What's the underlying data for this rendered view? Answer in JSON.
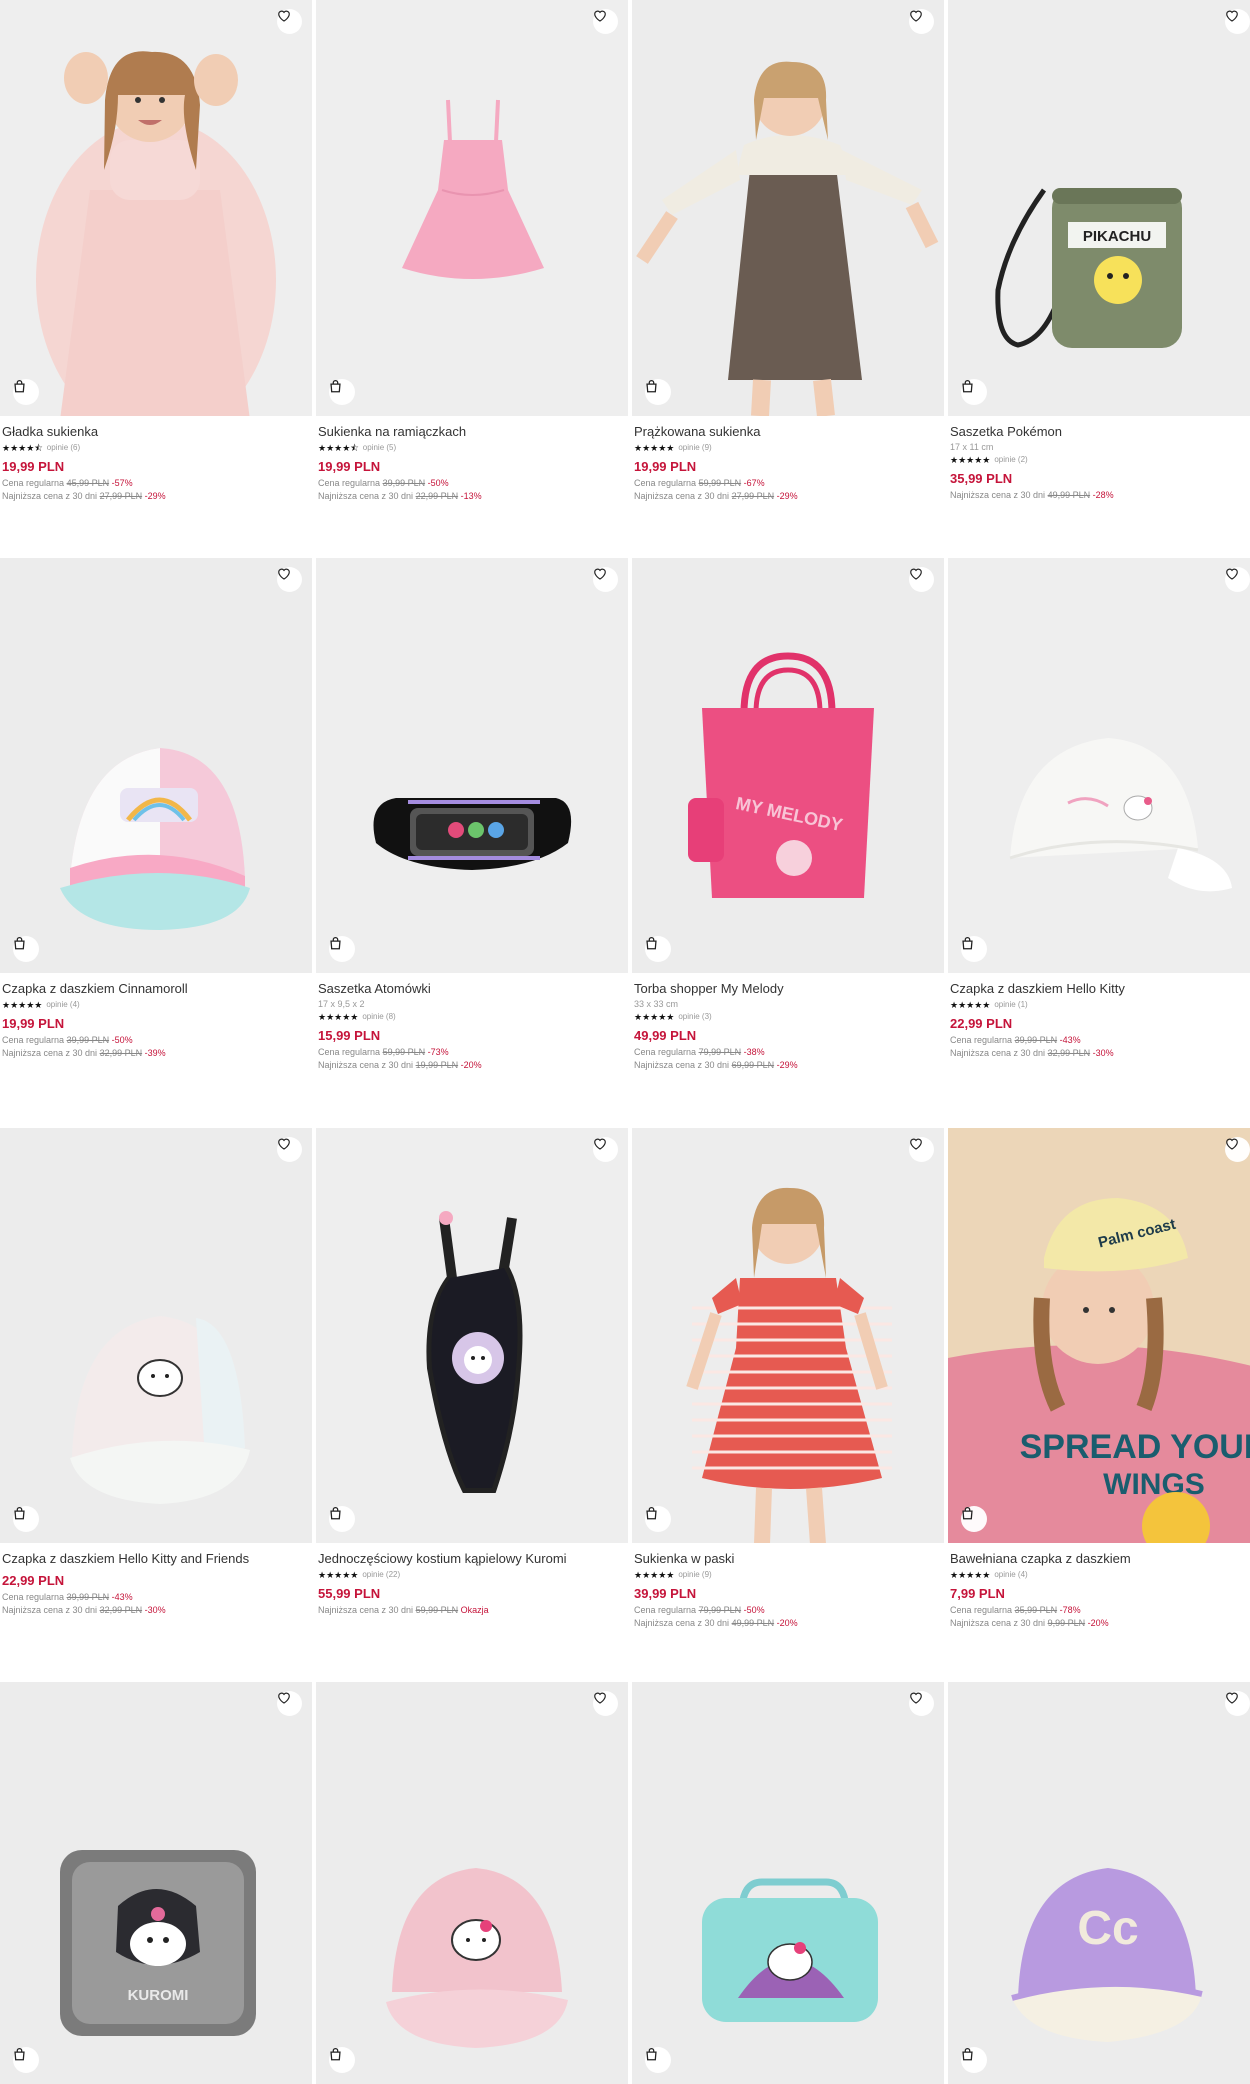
{
  "icons": {
    "favorite": "heart-icon",
    "add_to_cart": "shopping-bag-icon"
  },
  "colors": {
    "price": "#c5143a",
    "discount": "#c5143a"
  },
  "products": [
    {
      "name": "Gładka sukienka",
      "dims": "",
      "reviews": "opinie (6)",
      "rating": 4.5,
      "price": "19,99 PLN",
      "reg_label": "Cena regularna",
      "reg_price": "45,99 PLN",
      "reg_pct": "-57%",
      "low_label": "Najniższa cena z 30 dni",
      "low_price": "27,99 PLN",
      "low_pct": "-29%"
    },
    {
      "name": "Sukienka na ramiączkach",
      "dims": "",
      "reviews": "opinie (5)",
      "rating": 4.5,
      "price": "19,99 PLN",
      "reg_label": "Cena regularna",
      "reg_price": "39,99 PLN",
      "reg_pct": "-50%",
      "low_label": "Najniższa cena z 30 dni",
      "low_price": "22,99 PLN",
      "low_pct": "-13%"
    },
    {
      "name": "Prążkowana sukienka",
      "dims": "",
      "reviews": "opinie (9)",
      "rating": 5,
      "price": "19,99 PLN",
      "reg_label": "Cena regularna",
      "reg_price": "59,99 PLN",
      "reg_pct": "-67%",
      "low_label": "Najniższa cena z 30 dni",
      "low_price": "27,99 PLN",
      "low_pct": "-29%"
    },
    {
      "name": "Saszetka Pokémon",
      "dims": "17 x 11 cm",
      "reviews": "opinie (2)",
      "rating": 5,
      "price": "35,99 PLN",
      "reg_label": "",
      "reg_price": "",
      "reg_pct": "",
      "low_label": "Najniższa cena z 30 dni",
      "low_price": "49,99 PLN",
      "low_pct": "-28%"
    },
    {
      "name": "Czapka z daszkiem Cinnamoroll",
      "dims": "",
      "reviews": "opinie (4)",
      "rating": 5,
      "price": "19,99 PLN",
      "reg_label": "Cena regularna",
      "reg_price": "39,99 PLN",
      "reg_pct": "-50%",
      "low_label": "Najniższa cena z 30 dni",
      "low_price": "32,99 PLN",
      "low_pct": "-39%"
    },
    {
      "name": "Saszetka Atomówki",
      "dims": "17 x 9,5 x 2",
      "reviews": "opinie (8)",
      "rating": 5,
      "price": "15,99 PLN",
      "reg_label": "Cena regularna",
      "reg_price": "59,99 PLN",
      "reg_pct": "-73%",
      "low_label": "Najniższa cena z 30 dni",
      "low_price": "19,99 PLN",
      "low_pct": "-20%"
    },
    {
      "name": "Torba shopper My Melody",
      "dims": "33 x 33 cm",
      "reviews": "opinie (3)",
      "rating": 5,
      "price": "49,99 PLN",
      "reg_label": "Cena regularna",
      "reg_price": "79,99 PLN",
      "reg_pct": "-38%",
      "low_label": "Najniższa cena z 30 dni",
      "low_price": "69,99 PLN",
      "low_pct": "-29%"
    },
    {
      "name": "Czapka z daszkiem Hello Kitty",
      "dims": "",
      "reviews": "opinie (1)",
      "rating": 5,
      "price": "22,99 PLN",
      "reg_label": "Cena regularna",
      "reg_price": "39,99 PLN",
      "reg_pct": "-43%",
      "low_label": "Najniższa cena z 30 dni",
      "low_price": "32,99 PLN",
      "low_pct": "-30%"
    },
    {
      "name": "Czapka z daszkiem Hello Kitty and Friends",
      "dims": "",
      "reviews": "",
      "rating": 0,
      "price": "22,99 PLN",
      "reg_label": "Cena regularna",
      "reg_price": "39,99 PLN",
      "reg_pct": "-43%",
      "low_label": "Najniższa cena z 30 dni",
      "low_price": "32,99 PLN",
      "low_pct": "-30%"
    },
    {
      "name": "Jednoczęściowy kostium kąpielowy Kuromi",
      "dims": "",
      "reviews": "opinie (22)",
      "rating": 5,
      "price": "55,99 PLN",
      "reg_label": "",
      "reg_price": "",
      "reg_pct": "",
      "low_label": "Najniższa cena z 30 dni",
      "low_price": "59,99 PLN",
      "low_pct": "Okazja"
    },
    {
      "name": "Sukienka w paski",
      "dims": "",
      "reviews": "opinie (9)",
      "rating": 5,
      "price": "39,99 PLN",
      "reg_label": "Cena regularna",
      "reg_price": "79,99 PLN",
      "reg_pct": "-50%",
      "low_label": "Najniższa cena z 30 dni",
      "low_price": "49,99 PLN",
      "low_pct": "-20%"
    },
    {
      "name": "Bawełniana czapka z daszkiem",
      "dims": "",
      "reviews": "opinie (4)",
      "rating": 5,
      "price": "7,99 PLN",
      "reg_label": "Cena regularna",
      "reg_price": "35,99 PLN",
      "reg_pct": "-78%",
      "low_label": "Najniższa cena z 30 dni",
      "low_price": "9,99 PLN",
      "low_pct": "-20%"
    },
    {
      "name": "",
      "dims": "",
      "reviews": "",
      "rating": 0,
      "price": "",
      "reg_label": "",
      "reg_price": "",
      "reg_pct": "",
      "low_label": "",
      "low_price": "",
      "low_pct": ""
    },
    {
      "name": "",
      "dims": "",
      "reviews": "",
      "rating": 0,
      "price": "",
      "reg_label": "",
      "reg_price": "",
      "reg_pct": "",
      "low_label": "",
      "low_price": "",
      "low_pct": ""
    },
    {
      "name": "",
      "dims": "",
      "reviews": "",
      "rating": 0,
      "price": "",
      "reg_label": "",
      "reg_price": "",
      "reg_pct": "",
      "low_label": "",
      "low_price": "",
      "low_pct": ""
    },
    {
      "name": "",
      "dims": "",
      "reviews": "",
      "rating": 0,
      "price": "",
      "reg_label": "",
      "reg_price": "",
      "reg_pct": "",
      "low_label": "",
      "low_price": "",
      "low_pct": ""
    }
  ],
  "image_texts": {
    "pikachu": "PIKACHU",
    "melody": "MY MELODY",
    "kuromi": "KUROMI",
    "sweatshirt": "SPREAD YOUR WINGS",
    "cap_letters": "Cc"
  }
}
